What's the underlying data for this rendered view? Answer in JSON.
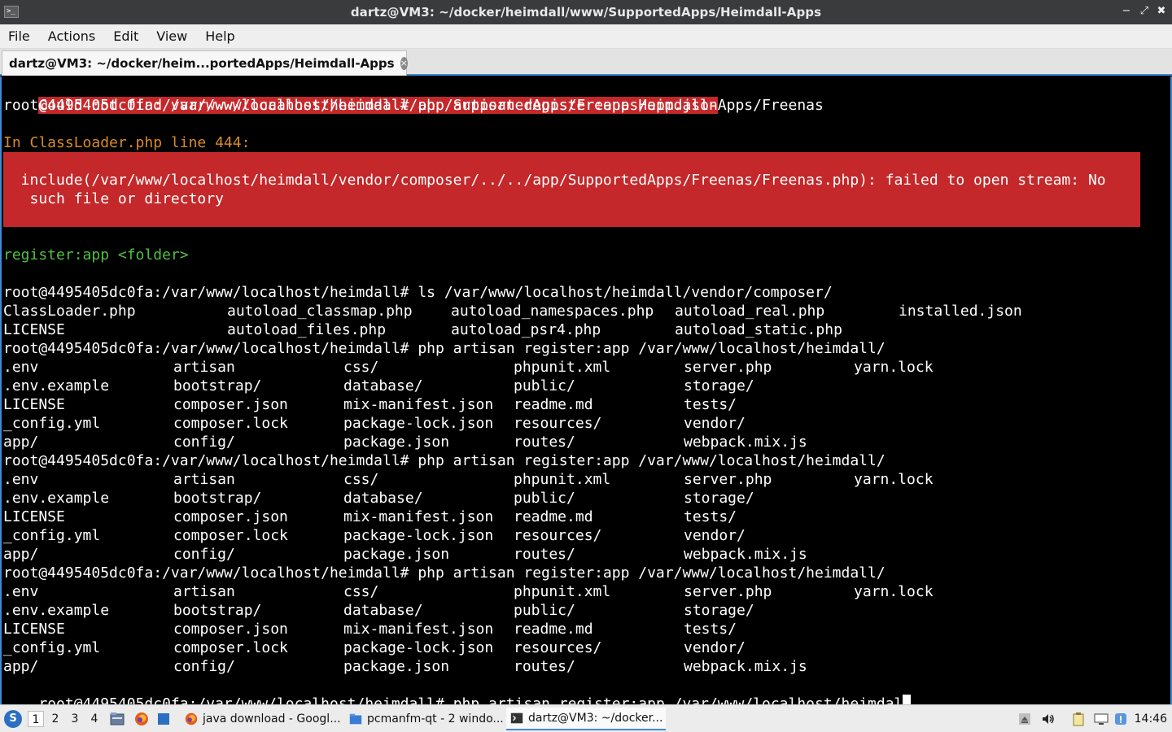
{
  "window": {
    "title": "dartz@VM3: ~/docker/heimdall/www/SupportedApps/Heimdall-Apps",
    "controls": {
      "minimize": "−",
      "maximize": "⤢",
      "close": "✖"
    }
  },
  "menu": [
    "File",
    "Actions",
    "Edit",
    "View",
    "Help"
  ],
  "tab": {
    "label": "dartz@VM3: ~/docker/heim...portedApps/Heimdall-Apps",
    "close": "×"
  },
  "terminal": {
    "line1": "Could not find /var/www/localhost/heimdall/app/SupportedApps/Freenas/app.json",
    "line2": "root@4495405dc0fa:/var/www/localhost/heimdall# php artisan register:app Heimdall-Apps/Freenas",
    "classloader": "In ClassLoader.php line 444:",
    "error1": "  include(/var/www/localhost/heimdall/vendor/composer/../../app/SupportedApps/Freenas/Freenas.php): failed to open stream: No",
    "error2": "   such file or directory",
    "usage": "register:app <folder>",
    "ls_cmd": "root@4495405dc0fa:/var/www/localhost/heimdall# ls /var/www/localhost/heimdall/vendor/composer/",
    "ls_rows": [
      [
        "ClassLoader.php",
        "autoload_classmap.php",
        "autoload_namespaces.php",
        "autoload_real.php",
        "installed.json"
      ],
      [
        "LICENSE",
        "autoload_files.php",
        "autoload_psr4.php",
        "autoload_static.php",
        ""
      ]
    ],
    "register_cmd": "root@4495405dc0fa:/var/www/localhost/heimdall# php artisan register:app /var/www/localhost/heimdall/",
    "dir_rows": [
      [
        ".env",
        "artisan",
        "css/",
        "phpunit.xml",
        "server.php",
        "yarn.lock"
      ],
      [
        ".env.example",
        "bootstrap/",
        "database/",
        "public/",
        "storage/",
        ""
      ],
      [
        "LICENSE",
        "composer.json",
        "mix-manifest.json",
        "readme.md",
        "tests/",
        ""
      ],
      [
        "_config.yml",
        "composer.lock",
        "package-lock.json",
        "resources/",
        "vendor/",
        ""
      ],
      [
        "app/",
        "config/",
        "package.json",
        "routes/",
        "webpack.mix.js",
        ""
      ]
    ],
    "prompt_final": "root@4495405dc0fa:/var/www/localhost/heimdall# php artisan register:app /var/www/localhost/heimdal"
  },
  "taskbar": {
    "desktops": [
      "1",
      "2",
      "3",
      "4"
    ],
    "tasks": [
      {
        "label": "java download - Googl..."
      },
      {
        "label": "pcmanfm-qt - 2 windo..."
      },
      {
        "label": "dartz@VM3: ~/docker..."
      }
    ],
    "clock": "14:46"
  },
  "colors": {
    "error_red": "#c4282a",
    "orange": "#d98a2a",
    "green": "#4fc23e",
    "accent": "#3e8ad6"
  }
}
